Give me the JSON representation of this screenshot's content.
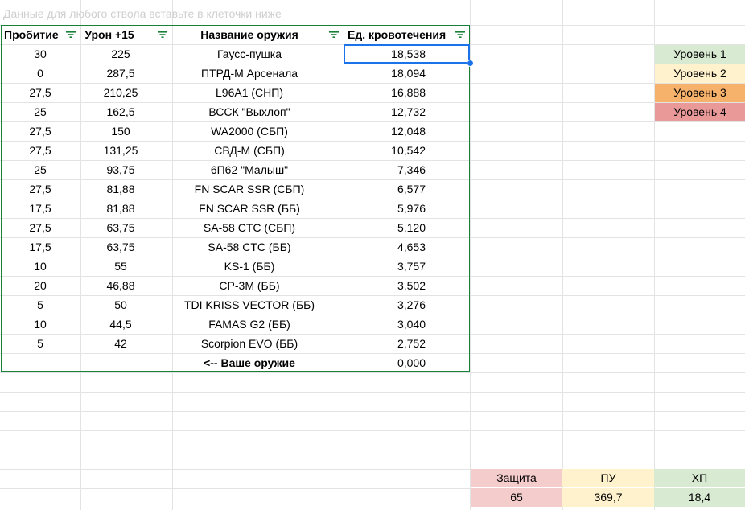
{
  "note": "Данные для любого ствола вставьте  в клеточки ниже",
  "headers": {
    "col1": "Пробитие",
    "col2": "Урон +15",
    "col3": "Название оружия",
    "col4": "Ед. кровотечения"
  },
  "rows": [
    {
      "pen": "30",
      "dmg": "225",
      "name": "Гаусс-пушка",
      "bleed": "18,538"
    },
    {
      "pen": "0",
      "dmg": "287,5",
      "name": "ПТРД-М Арсенала",
      "bleed": "18,094"
    },
    {
      "pen": "27,5",
      "dmg": "210,25",
      "name": "L96A1 (СНП)",
      "bleed": "16,888"
    },
    {
      "pen": "25",
      "dmg": "162,5",
      "name": "ВССК \"Выхлоп\"",
      "bleed": "12,732"
    },
    {
      "pen": "27,5",
      "dmg": "150",
      "name": "WA2000 (СБП)",
      "bleed": "12,048"
    },
    {
      "pen": "27,5",
      "dmg": "131,25",
      "name": "СВД-М (СБП)",
      "bleed": "10,542"
    },
    {
      "pen": "25",
      "dmg": "93,75",
      "name": "6П62 \"Малыш\"",
      "bleed": "7,346"
    },
    {
      "pen": "27,5",
      "dmg": "81,88",
      "name": "FN SCAR SSR (СБП)",
      "bleed": "6,577"
    },
    {
      "pen": "17,5",
      "dmg": "81,88",
      "name": "FN SCAR SSR (ББ)",
      "bleed": "5,976"
    },
    {
      "pen": "27,5",
      "dmg": "63,75",
      "name": "SA-58 CTC (СБП)",
      "bleed": "5,120"
    },
    {
      "pen": "17,5",
      "dmg": "63,75",
      "name": "SA-58 CTC (ББ)",
      "bleed": "4,653"
    },
    {
      "pen": "10",
      "dmg": "55",
      "name": "KS-1 (ББ)",
      "bleed": "3,757"
    },
    {
      "pen": "20",
      "dmg": "46,88",
      "name": "CP-3M (ББ)",
      "bleed": "3,502"
    },
    {
      "pen": "5",
      "dmg": "50",
      "name": "TDI KRISS VECTOR (ББ)",
      "bleed": "3,276"
    },
    {
      "pen": "10",
      "dmg": "44,5",
      "name": "FAMAS G2 (ББ)",
      "bleed": "3,040"
    },
    {
      "pen": "5",
      "dmg": "42",
      "name": "Scorpion EVO (ББ)",
      "bleed": "2,752"
    },
    {
      "pen": "",
      "dmg": "",
      "name": "<-- Ваше оружие",
      "bleed": "0,000"
    }
  ],
  "levels": [
    {
      "label": "Уровень 1",
      "color": "#d9ead3"
    },
    {
      "label": "Уровень 2",
      "color": "#fff2cc"
    },
    {
      "label": "Уровень 3",
      "color": "#f6b26b"
    },
    {
      "label": "Уровень 4",
      "color": "#ea9999"
    }
  ],
  "stats": {
    "defense": {
      "label": "Защита",
      "value": "65",
      "color": "#f4cccc"
    },
    "pu": {
      "label": "ПУ",
      "value": "369,7",
      "color": "#fff2cc"
    },
    "hp": {
      "label": "ХП",
      "value": "18,4",
      "color": "#d9ead3"
    }
  },
  "colors": {
    "table_border": "#188038",
    "selection": "#1a73e8",
    "filter_icon": "#188038"
  },
  "icons": {
    "filter": "filter-icon"
  }
}
